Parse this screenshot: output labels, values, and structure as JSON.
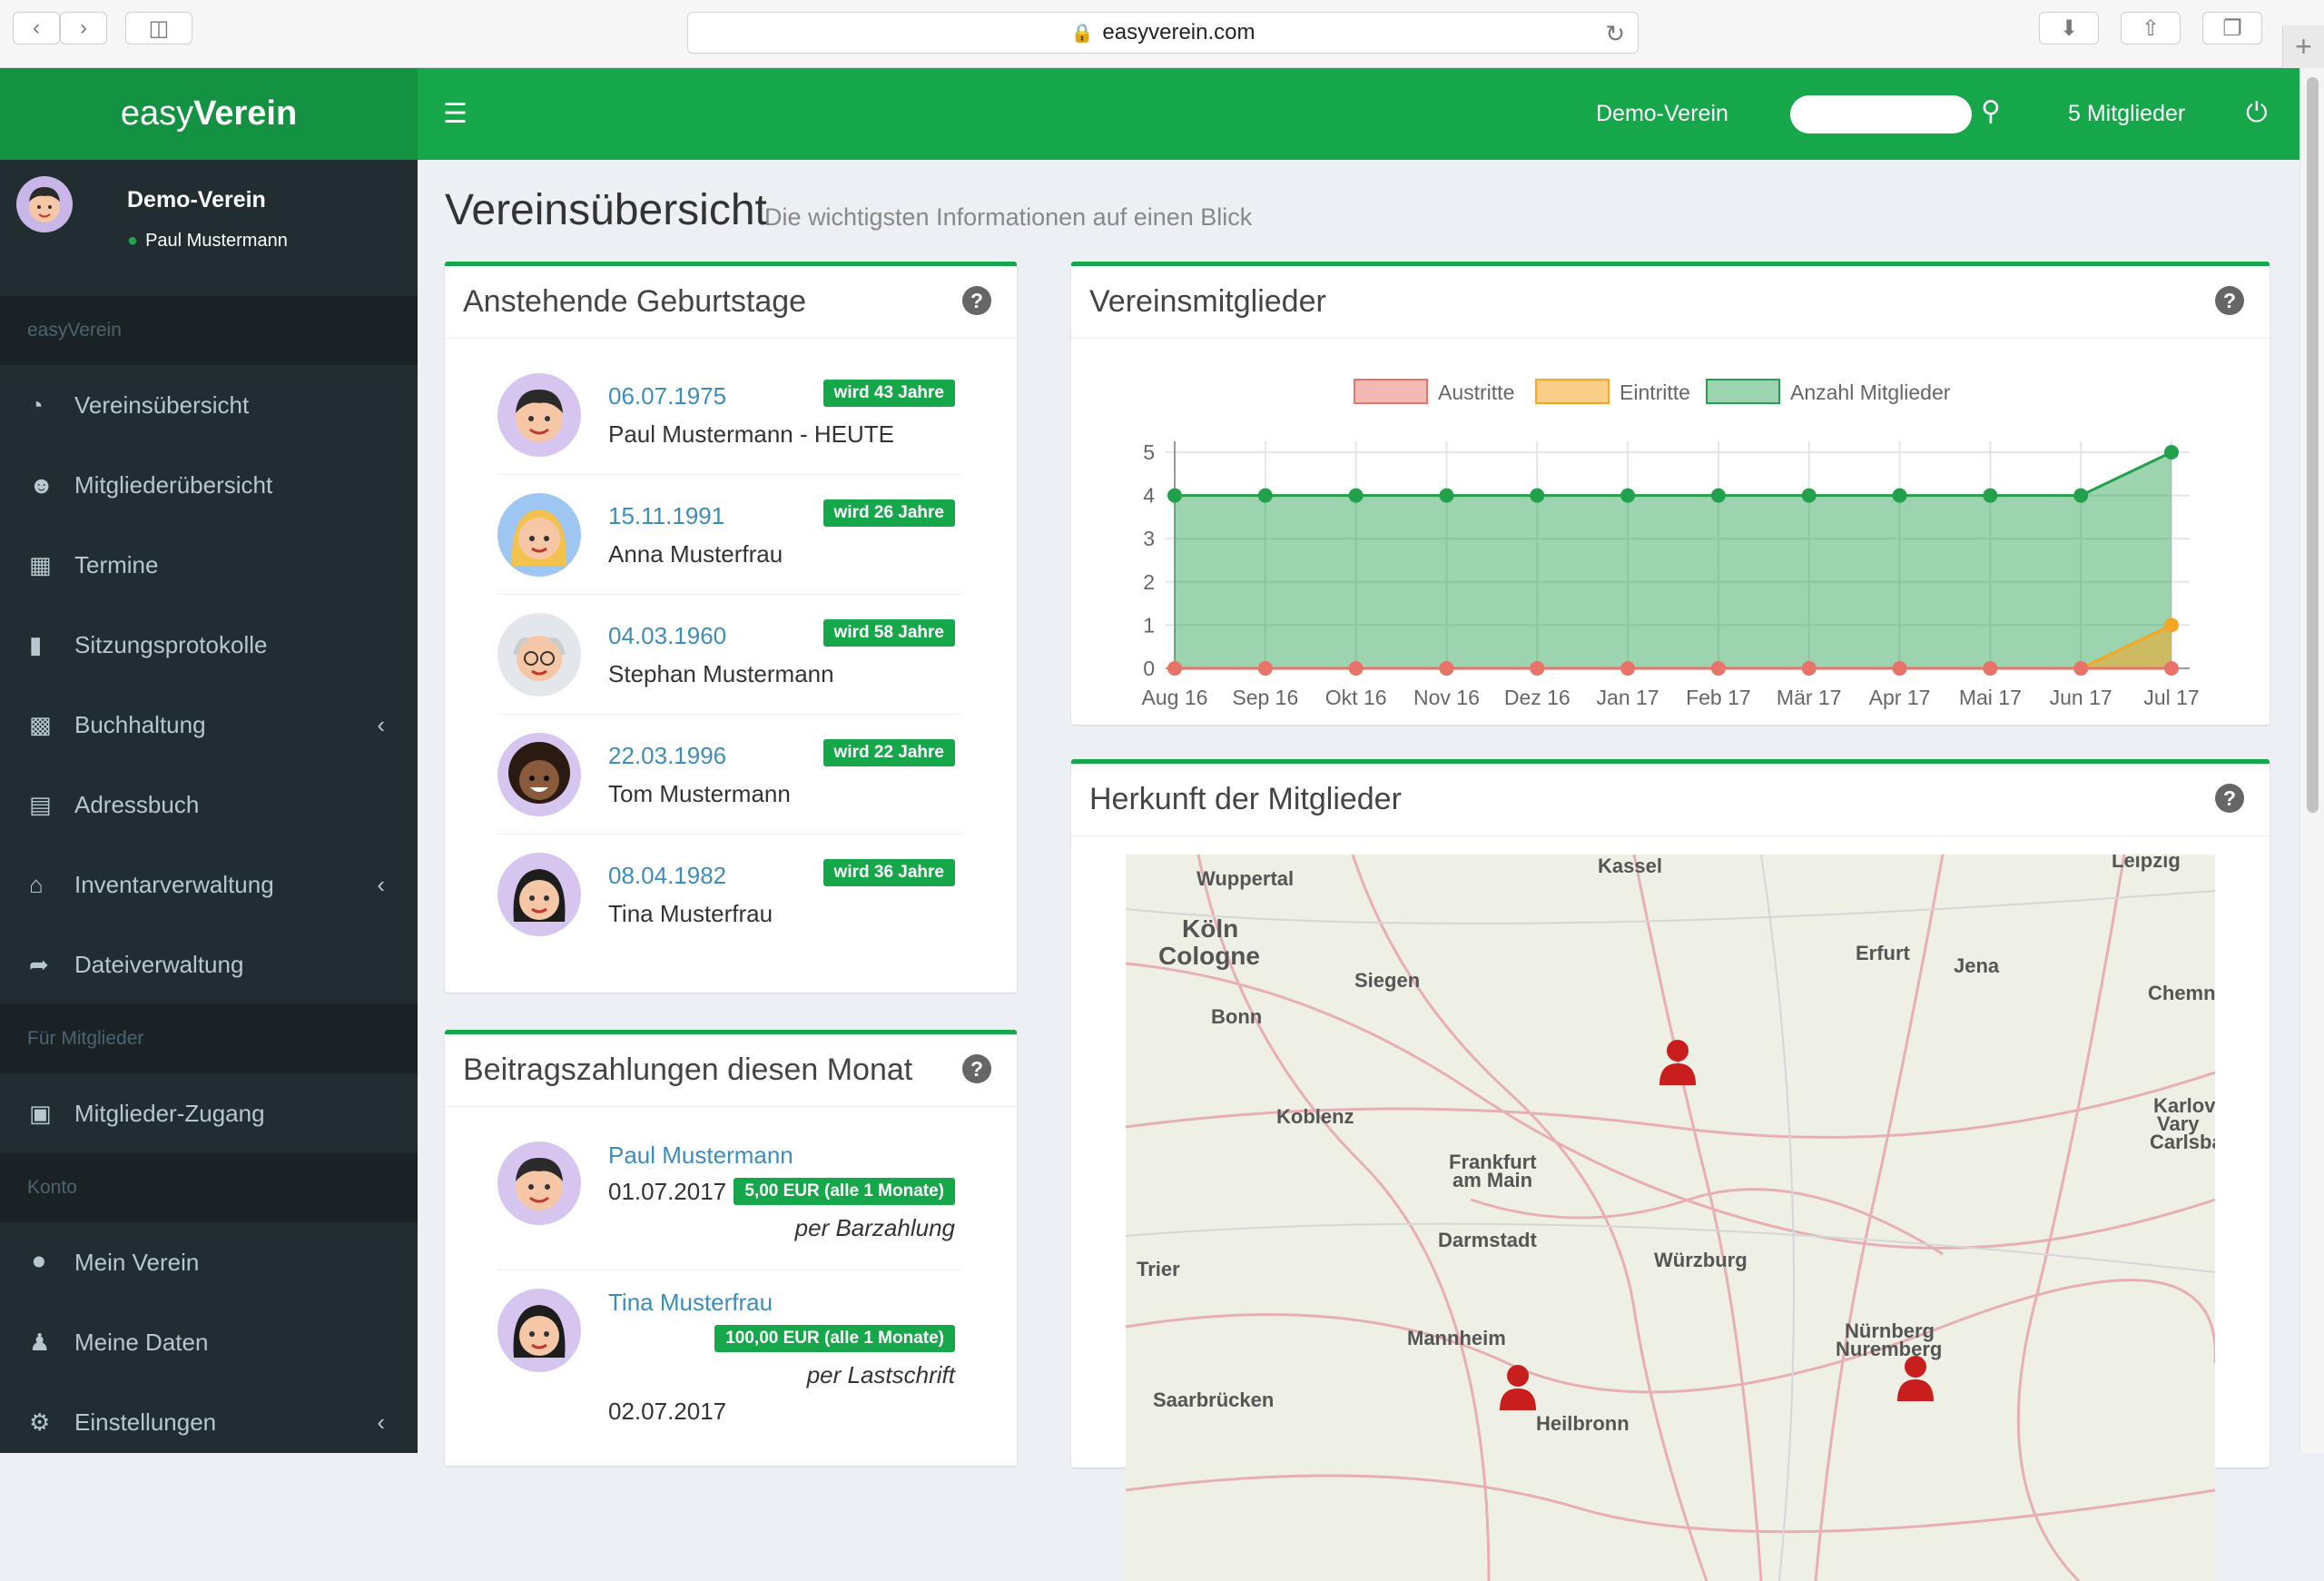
{
  "browser": {
    "url": "easyverein.com"
  },
  "topbar": {
    "logo_light": "easy",
    "logo_bold": "Verein",
    "club": "Demo-Verein",
    "members": "5 Mitglieder"
  },
  "user": {
    "club": "Demo-Verein",
    "name": "Paul Mustermann"
  },
  "sidebar": {
    "section_main": "easyVerein",
    "section_members": "Für Mitglieder",
    "section_account": "Konto",
    "items": [
      {
        "label": "Vereinsübersicht",
        "icon": "dashboard-icon"
      },
      {
        "label": "Mitgliederübersicht",
        "icon": "users-icon"
      },
      {
        "label": "Termine",
        "icon": "calendar-icon"
      },
      {
        "label": "Sitzungsprotokolle",
        "icon": "file-icon"
      },
      {
        "label": "Buchhaltung",
        "icon": "money-icon"
      },
      {
        "label": "Adressbuch",
        "icon": "book-icon"
      },
      {
        "label": "Inventarverwaltung",
        "icon": "home-icon"
      },
      {
        "label": "Dateiverwaltung",
        "icon": "share-icon"
      }
    ],
    "member_items": [
      {
        "label": "Mitglieder-Zugang",
        "icon": "image-icon"
      }
    ],
    "account_items": [
      {
        "label": "Mein Verein",
        "icon": "tag-icon"
      },
      {
        "label": "Meine Daten",
        "icon": "user-icon"
      },
      {
        "label": "Einstellungen",
        "icon": "gear-icon"
      }
    ]
  },
  "page": {
    "title": "Vereinsübersicht",
    "subtitle": "Die wichtigsten Informationen auf einen Blick"
  },
  "birthdays": {
    "title": "Anstehende Geburtstage",
    "rows": [
      {
        "date": "06.07.1975",
        "name": "Paul Mustermann - HEUTE",
        "badge": "wird 43 Jahre"
      },
      {
        "date": "15.11.1991",
        "name": "Anna Musterfrau",
        "badge": "wird 26 Jahre"
      },
      {
        "date": "04.03.1960",
        "name": "Stephan Mustermann",
        "badge": "wird 58 Jahre"
      },
      {
        "date": "22.03.1996",
        "name": "Tom Mustermann",
        "badge": "wird 22 Jahre"
      },
      {
        "date": "08.04.1982",
        "name": "Tina Musterfrau",
        "badge": "wird 36 Jahre"
      }
    ]
  },
  "payments": {
    "title": "Beitragszahlungen diesen Monat",
    "rows": [
      {
        "name": "Paul Mustermann",
        "date": "01.07.2017",
        "badge": "5,00 EUR (alle 1 Monate)",
        "method": "per Barzahlung"
      },
      {
        "name": "Tina Musterfrau",
        "date": "02.07.2017",
        "badge": "100,00 EUR (alle 1 Monate)",
        "method": "per Lastschrift"
      }
    ]
  },
  "members_box": {
    "title": "Vereinsmitglieder"
  },
  "origin_box": {
    "title": "Herkunft der Mitglieder",
    "cities": [
      "Wuppertal",
      "Köln",
      "Cologne",
      "Bonn",
      "Siegen",
      "Kassel",
      "Erfurt",
      "Jena",
      "Leipzig",
      "Chemn",
      "Koblenz",
      "Frankfurt",
      "am Main",
      "Darmstadt",
      "Würzburg",
      "Trier",
      "Mannheim",
      "Nürnberg",
      "Nuremberg",
      "Saarbrücken",
      "Heilbronn",
      "Karlov",
      "Vary",
      "Carlsba"
    ]
  },
  "chart_data": {
    "type": "line",
    "categories": [
      "Aug 16",
      "Sep 16",
      "Okt 16",
      "Nov 16",
      "Dez 16",
      "Jan 17",
      "Feb 17",
      "Mär 17",
      "Apr 17",
      "Mai 17",
      "Jun 17",
      "Jul 17"
    ],
    "series": [
      {
        "name": "Austritte",
        "values": [
          0,
          0,
          0,
          0,
          0,
          0,
          0,
          0,
          0,
          0,
          0,
          0
        ],
        "color": "#e8736b"
      },
      {
        "name": "Eintritte",
        "values": [
          0,
          0,
          0,
          0,
          0,
          0,
          0,
          0,
          0,
          0,
          0,
          1
        ],
        "color": "#f5a623"
      },
      {
        "name": "Anzahl Mitglieder",
        "values": [
          4,
          4,
          4,
          4,
          4,
          4,
          4,
          4,
          4,
          4,
          4,
          5
        ],
        "color": "#22a04b"
      }
    ],
    "yticks": [
      "0",
      "1",
      "2",
      "3",
      "4",
      "5"
    ],
    "ylim": [
      0,
      5
    ],
    "grid": true,
    "legend": "top"
  },
  "colors": {
    "brand": "#17a74b",
    "sidebar": "#222d32",
    "link": "#3c8dbc"
  }
}
